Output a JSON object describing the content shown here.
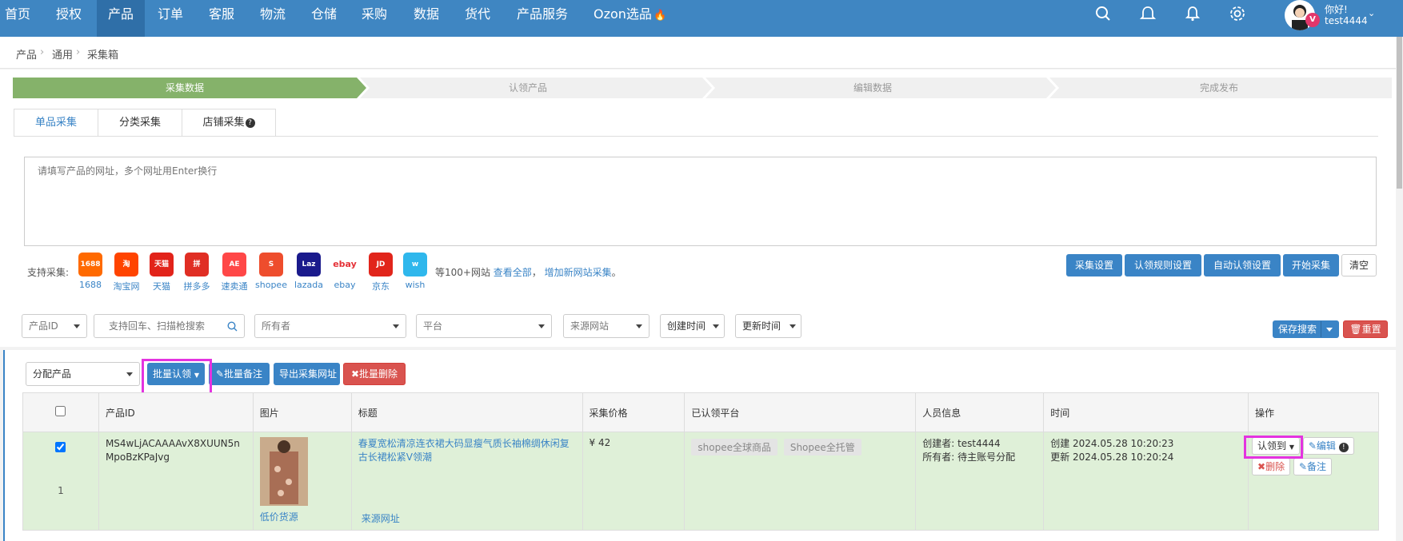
{
  "nav": {
    "items": [
      "首页",
      "授权",
      "产品",
      "订单",
      "客服",
      "物流",
      "仓储",
      "采购",
      "数据",
      "货代",
      "产品服务",
      "Ozon选品"
    ],
    "active": "产品",
    "greeting": "你好!",
    "username": "test4444",
    "badge": "V",
    "icons": [
      "search-icon",
      "chat-icon",
      "bell-icon",
      "gear-icon",
      "fire-icon"
    ]
  },
  "breadcrumb": [
    "产品",
    "通用",
    "采集箱"
  ],
  "steps": [
    "采集数据",
    "认领产品",
    "编辑数据",
    "完成发布"
  ],
  "tabs": [
    "单品采集",
    "分类采集",
    "店铺采集"
  ],
  "url_input": {
    "placeholder": "请填写产品的网址，多个网址用Enter换行"
  },
  "support": {
    "label": "支持采集:",
    "sites": [
      {
        "name": "1688",
        "color": "#ff6a00",
        "logo": "1688"
      },
      {
        "name": "淘宝网",
        "color": "#ff4400",
        "logo": "淘"
      },
      {
        "name": "天猫",
        "color": "#e2231a",
        "logo": "天猫"
      },
      {
        "name": "拼多多",
        "color": "#e02e24",
        "logo": "拼"
      },
      {
        "name": "速卖通",
        "color": "#ff4747",
        "logo": "AE"
      },
      {
        "name": "shopee",
        "color": "#ee4d2d",
        "logo": "S"
      },
      {
        "name": "lazada",
        "color": "#1a1a8c",
        "logo": "Laz"
      },
      {
        "name": "ebay",
        "color": "#ffffff",
        "logo": "ebay"
      },
      {
        "name": "京东",
        "color": "#e1251b",
        "logo": "JD"
      },
      {
        "name": "wish",
        "color": "#2fb7ec",
        "logo": "w"
      }
    ],
    "more_text": "等100+网站",
    "view_all": "查看全部",
    "comma": "，",
    "add_site": "增加新网站采集",
    "period": "。"
  },
  "actions": {
    "collect_settings": "采集设置",
    "claim_rules": "认领规则设置",
    "auto_claim": "自动认领设置",
    "start_collect": "开始采集",
    "clear": "清空"
  },
  "filters": {
    "product_id": "产品ID",
    "search_placeholder": "支持回车、扫描枪搜索",
    "owner": "所有者",
    "platform": "平台",
    "source_site": "来源网站",
    "created_time": "创建时间",
    "updated_time": "更新时间",
    "save_search": "保存搜索",
    "reset": "重置"
  },
  "bulk": {
    "assign": "分配产品",
    "batch_claim": "批量认领",
    "batch_note": "批量备注",
    "export_urls": "导出采集网址",
    "batch_delete": "批量删除"
  },
  "table": {
    "headers": [
      "",
      "产品ID",
      "图片",
      "标题",
      "采集价格",
      "已认领平台",
      "人员信息",
      "时间",
      "操作"
    ],
    "rows": [
      {
        "checked": true,
        "index": "1",
        "product_id": "MS4wLjACAAAAvX8XUUN5nMpoBzKPaJvg",
        "image_label": "低价货源",
        "title": "春夏宽松清凉连衣裙大码显瘦气质长袖棉绸休闲复古长裙松紧V领潮",
        "source_link": "来源网址",
        "price": "¥ 42",
        "platforms": [
          "shopee全球商品",
          "Shopee全托管"
        ],
        "creator_label": "创建者:",
        "creator": "test4444",
        "owner_label": "所有者:",
        "owner": "待主账号分配",
        "created": "创建 2024.05.28 10:20:23",
        "updated": "更新 2024.05.28 10:20:24",
        "ops": {
          "claim_to": "认领到",
          "edit": "编辑",
          "delete": "删除",
          "note": "备注"
        }
      }
    ]
  }
}
